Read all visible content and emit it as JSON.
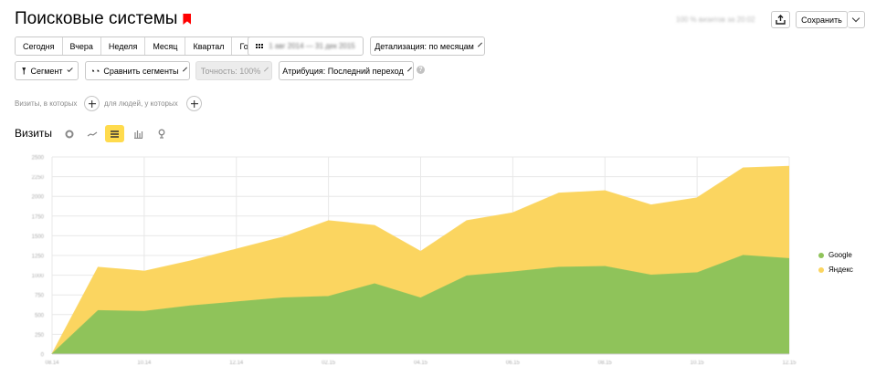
{
  "header": {
    "title": "Поисковые системы",
    "sampling_note": "100 % визитов за 20:02",
    "save_label": "Сохранить"
  },
  "periods": [
    "Сегодня",
    "Вчера",
    "Неделя",
    "Месяц",
    "Квартал",
    "Год"
  ],
  "date_range": "1 авг 2014 — 31 дек 2015",
  "detail_label": "Детализация: по месяцам",
  "segment_label": "Сегмент",
  "compare_label": "Сравнить сегменты",
  "accuracy_label": "Точность: 100%",
  "attribution_label": "Атрибуция: Последний переход",
  "filters": {
    "visits_which": "Визиты, в которых",
    "for_people": "для людей, у которых"
  },
  "chart_header": {
    "label": "Визиты",
    "types": [
      "pie-icon",
      "line-icon",
      "stacked-area-icon",
      "bar-icon",
      "map-icon"
    ]
  },
  "chart_data": {
    "type": "area",
    "stacked": true,
    "x": [
      "08.14",
      "09.14",
      "10.14",
      "11.14",
      "12.14",
      "01.15",
      "02.15",
      "03.15",
      "04.15",
      "05.15",
      "06.15",
      "07.15",
      "08.15",
      "09.15",
      "10.15",
      "11.15",
      "12.15"
    ],
    "x_tick_labels": [
      "08.14",
      "10.14",
      "12.14",
      "02.15",
      "04.15",
      "06.15",
      "08.15",
      "10.15",
      "12.15"
    ],
    "y_tick_labels": [
      "0",
      "250",
      "500",
      "750",
      "1000",
      "1250",
      "1500",
      "1750",
      "2000",
      "2250",
      "2500"
    ],
    "ylim": [
      0,
      2500
    ],
    "series": [
      {
        "name": "Google",
        "color": "#8fc35a",
        "values": [
          0,
          550,
          540,
          610,
          660,
          710,
          730,
          890,
          710,
          990,
          1040,
          1100,
          1110,
          1000,
          1030,
          1250,
          1210
        ]
      },
      {
        "name": "Яндекс",
        "color": "#fbd560",
        "values": [
          0,
          550,
          510,
          570,
          670,
          770,
          960,
          740,
          590,
          700,
          750,
          940,
          960,
          890,
          950,
          1110,
          1170
        ]
      }
    ],
    "legend_position": "right",
    "grid": true
  }
}
